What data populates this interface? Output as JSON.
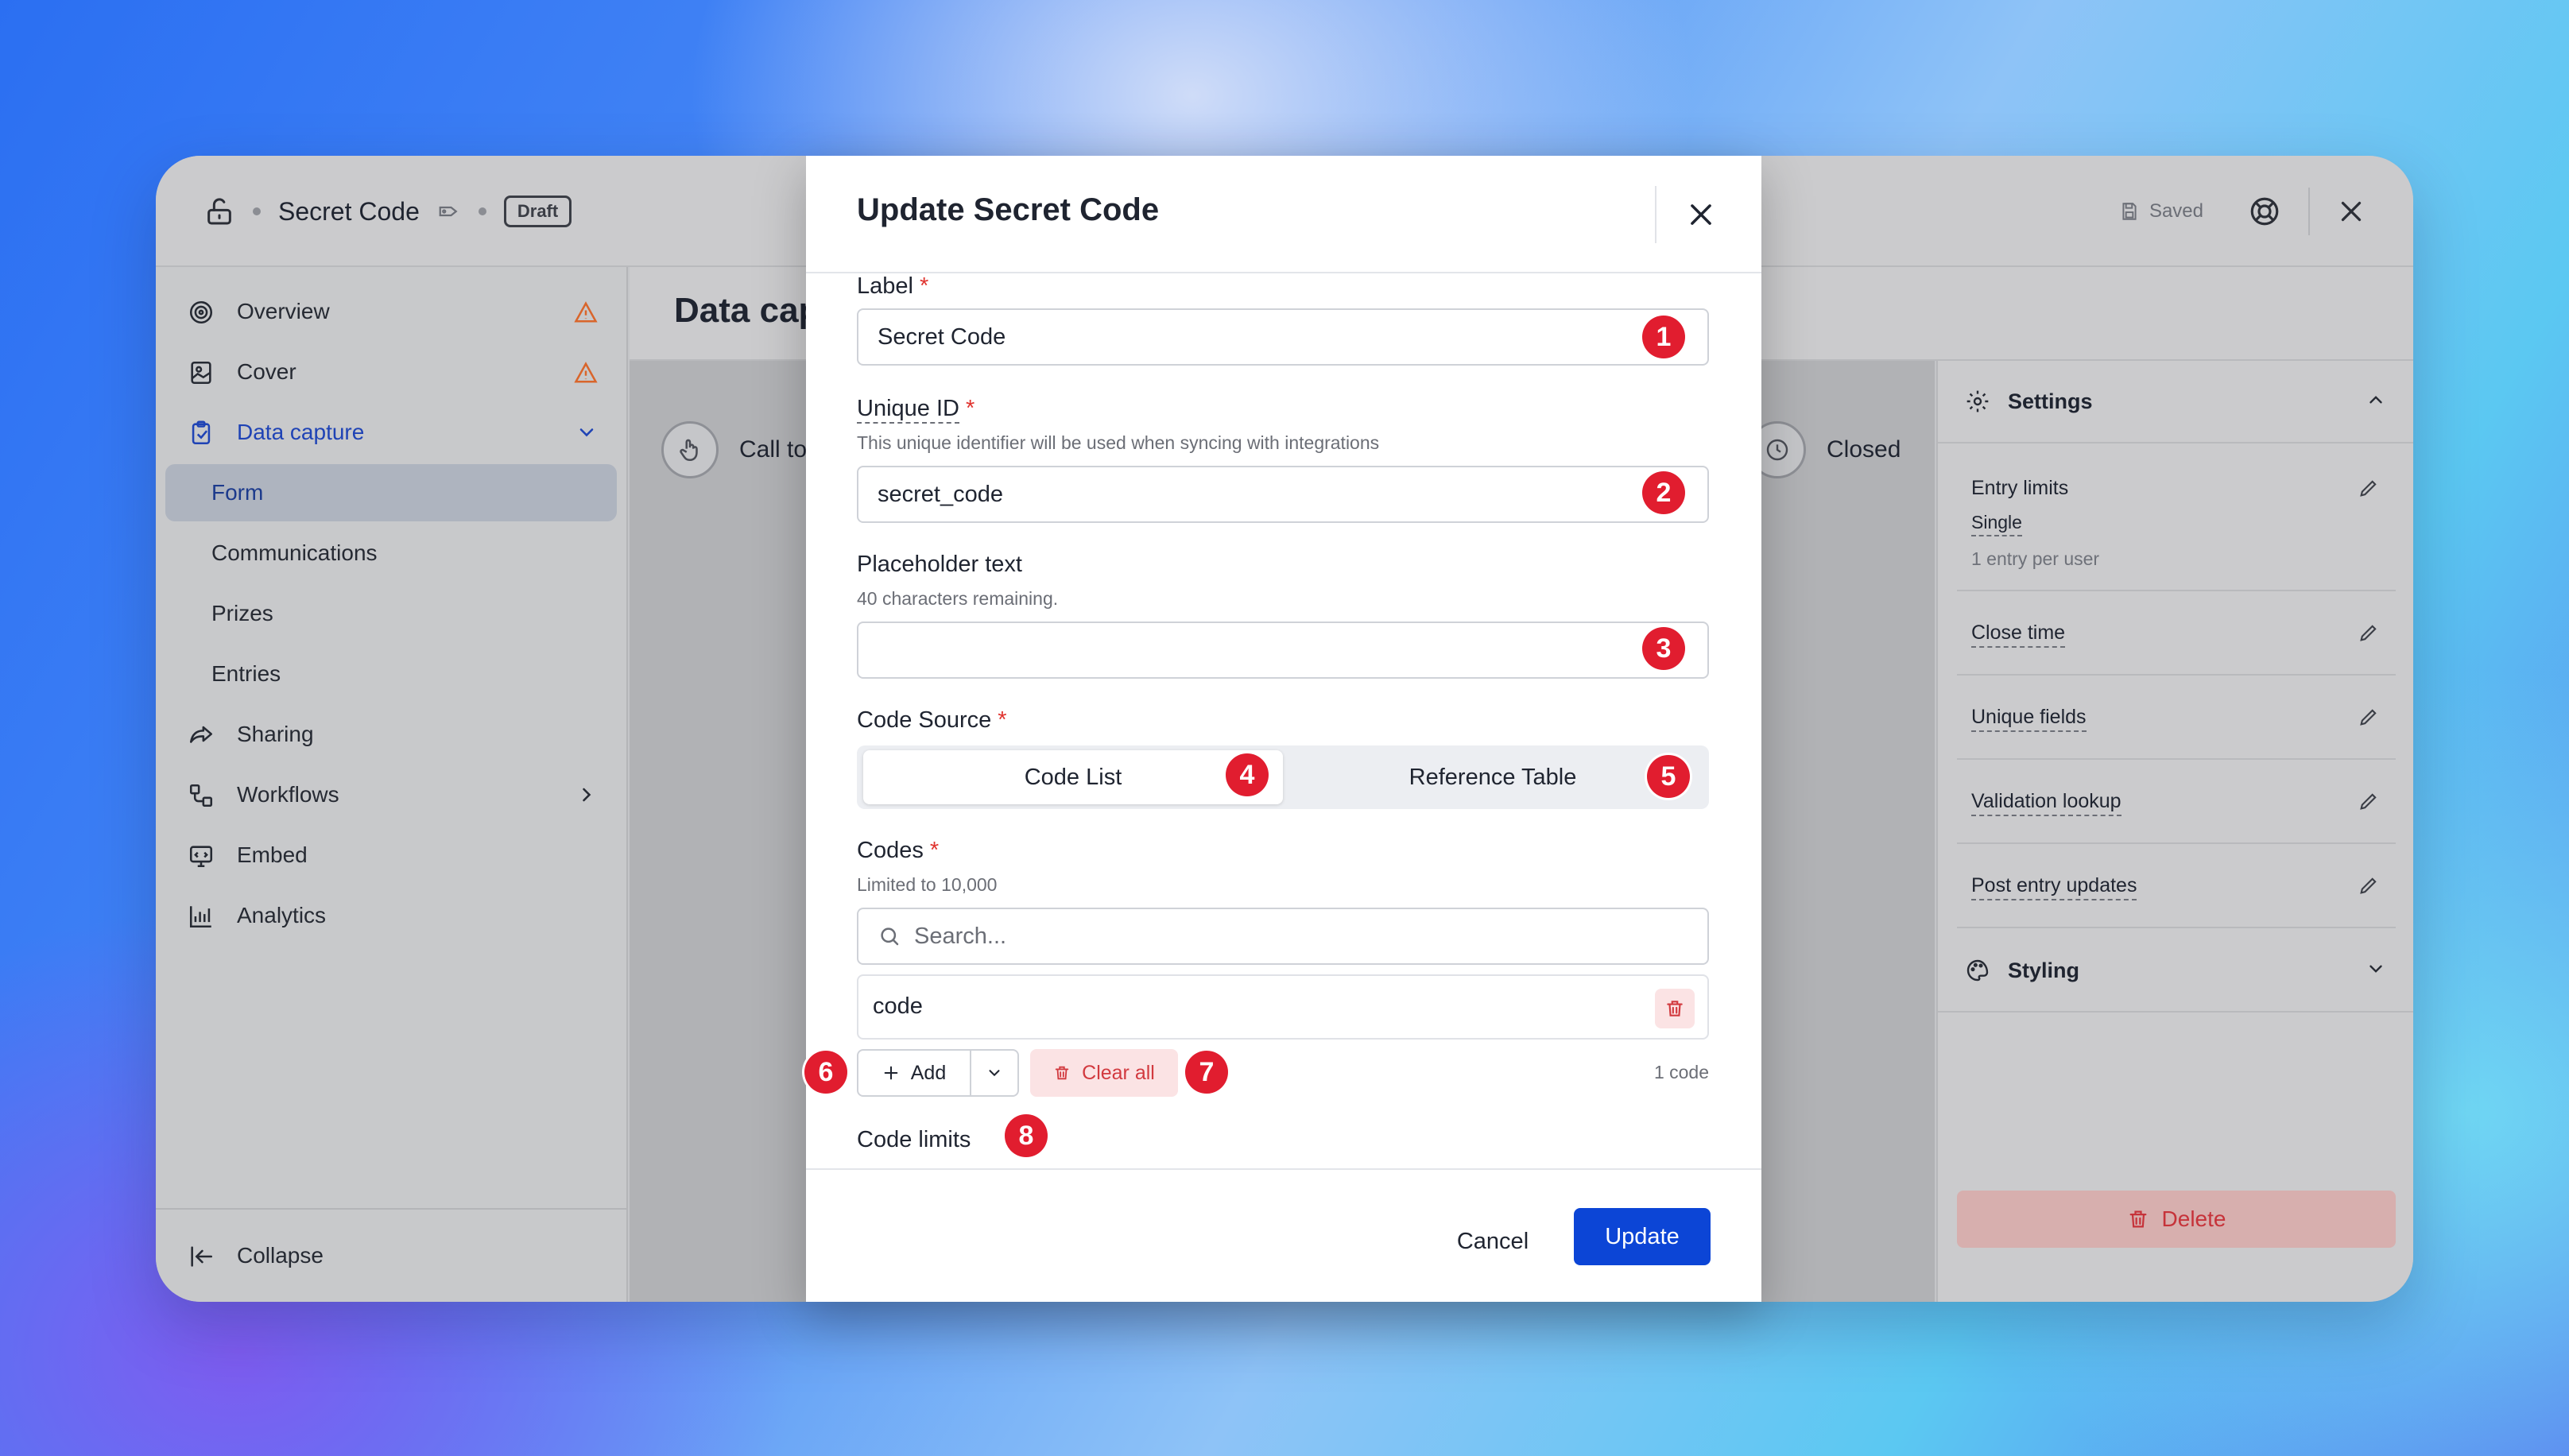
{
  "header": {
    "title": "Secret Code",
    "badge": "Draft",
    "saved_label": "Saved"
  },
  "sidebar": {
    "items": [
      {
        "label": "Overview",
        "icon": "target-icon",
        "warning": true
      },
      {
        "label": "Cover",
        "icon": "image-icon",
        "warning": true
      },
      {
        "label": "Data capture",
        "icon": "clipboard-icon",
        "expanded": true
      },
      {
        "label": "Form",
        "active": true
      },
      {
        "label": "Communications"
      },
      {
        "label": "Prizes"
      },
      {
        "label": "Entries"
      },
      {
        "label": "Sharing",
        "icon": "share-icon"
      },
      {
        "label": "Workflows",
        "icon": "workflow-icon"
      },
      {
        "label": "Embed",
        "icon": "embed-icon"
      },
      {
        "label": "Analytics",
        "icon": "chart-icon"
      }
    ],
    "collapse_label": "Collapse"
  },
  "main": {
    "title": "Data cap",
    "flow_left": "Call to",
    "flow_right": "Closed"
  },
  "right_panel": {
    "settings_title": "Settings",
    "entry_limits": {
      "label": "Entry limits",
      "value": "Single",
      "desc": "1 entry per user"
    },
    "rows": [
      "Close time",
      "Unique fields",
      "Validation lookup",
      "Post entry updates"
    ],
    "styling_title": "Styling",
    "delete_label": "Delete"
  },
  "modal": {
    "title": "Update Secret Code",
    "label_field": {
      "label": "Label",
      "value": "Secret Code"
    },
    "unique_id": {
      "label": "Unique ID",
      "hint": "This unique identifier will be used when syncing with integrations",
      "value": "secret_code"
    },
    "placeholder": {
      "label": "Placeholder text",
      "hint": "40 characters remaining.",
      "value": ""
    },
    "code_source": {
      "label": "Code Source",
      "options": [
        "Code List",
        "Reference Table"
      ],
      "selected": "Code List"
    },
    "codes": {
      "label": "Codes",
      "hint": "Limited to 10,000",
      "search_placeholder": "Search...",
      "items": [
        "code"
      ],
      "add_label": "Add",
      "clear_label": "Clear all",
      "count": "1 code"
    },
    "code_limits_label": "Code limits",
    "cancel_label": "Cancel",
    "update_label": "Update"
  },
  "markers": [
    "1",
    "2",
    "3",
    "4",
    "5",
    "6",
    "7",
    "8"
  ],
  "colors": {
    "accent": "#0c45d6",
    "danger": "#e11d2f",
    "warning": "#d9652b"
  }
}
